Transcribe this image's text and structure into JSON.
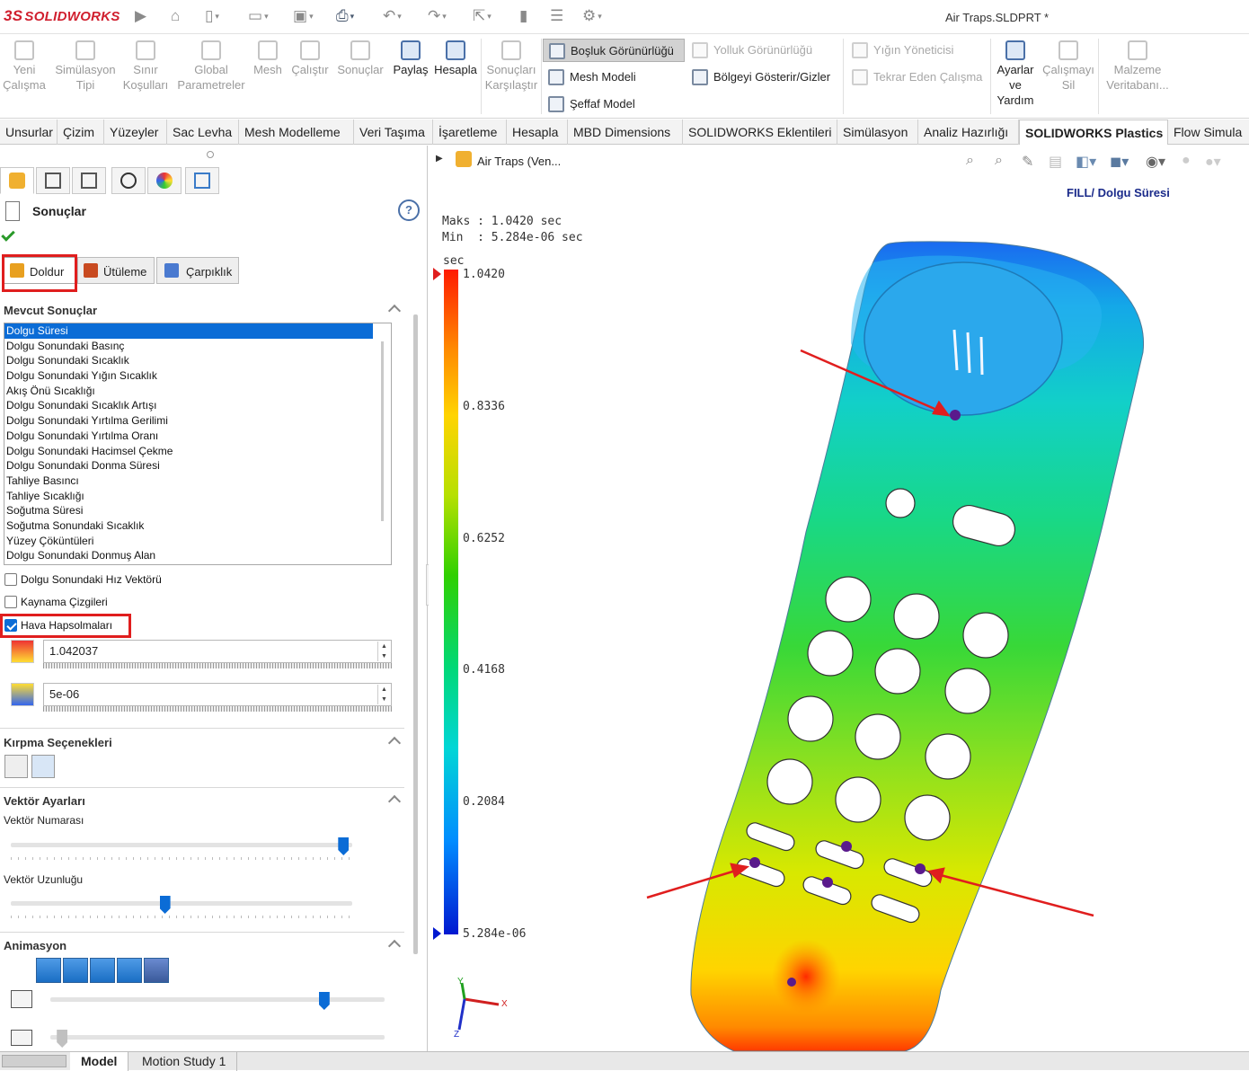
{
  "app": {
    "logo": "SOLIDWORKS",
    "logo_mark": "3S",
    "document_title": "Air Traps.SLDPRT *"
  },
  "ribbon": {
    "buttons": [
      {
        "label": "Yeni Çalışma",
        "icon": "new-study-icon",
        "enabled": false
      },
      {
        "label": "Simülasyon Tipi",
        "icon": "simulation-type-icon",
        "enabled": false
      },
      {
        "label": "Sınır Koşulları",
        "icon": "boundary-conditions-icon",
        "enabled": false
      },
      {
        "label": "Global Parametreler",
        "icon": "global-parameters-icon",
        "enabled": false
      },
      {
        "label": "Mesh",
        "icon": "mesh-icon",
        "enabled": false
      },
      {
        "label": "Çalıştır",
        "icon": "run-icon",
        "enabled": false
      },
      {
        "label": "Sonuçlar",
        "icon": "results-icon",
        "enabled": false
      },
      {
        "label": "Paylaş",
        "icon": "share-icon",
        "enabled": true
      },
      {
        "label": "Hesapla",
        "icon": "calculate-icon",
        "enabled": true
      },
      {
        "label": "Sonuçları Karşılaştır",
        "icon": "compare-results-icon",
        "enabled": false
      }
    ],
    "small_buttons": [
      {
        "label": "Boşluk Görünürlüğü",
        "icon": "cavity-visibility-icon",
        "selected": true
      },
      {
        "label": "Mesh Modeli",
        "icon": "mesh-model-icon"
      },
      {
        "label": "Şeffaf Model",
        "icon": "transparent-model-icon"
      },
      {
        "label": "Yolluk Görünürlüğü",
        "icon": "runner-visibility-icon",
        "enabled": false
      },
      {
        "label": "Bölgeyi Gösterir/Gizler",
        "icon": "show-hide-region-icon"
      },
      {
        "label": "Yığın Yöneticisi",
        "icon": "batch-manager-icon",
        "enabled": false
      },
      {
        "label": "Tekrar Eden Çalışma",
        "icon": "repeat-study-icon",
        "enabled": false
      }
    ],
    "right_buttons": [
      {
        "label": "Ayarlar ve Yardım",
        "icon": "settings-help-icon",
        "enabled": true
      },
      {
        "label": "Çalışmayı Sil",
        "icon": "delete-study-icon",
        "enabled": false
      },
      {
        "label": "Malzeme Veritabanı...",
        "icon": "material-database-icon",
        "enabled": false
      }
    ]
  },
  "tabs": [
    "Unsurlar",
    "Çizim",
    "Yüzeyler",
    "Sac Levha",
    "Mesh Modelleme",
    "Veri Taşıma",
    "İşaretleme",
    "Hesapla",
    "MBD Dimensions",
    "SOLIDWORKS Eklentileri",
    "Simülasyon",
    "Analiz Hazırlığı",
    "SOLIDWORKS Plastics",
    "Flow Simula"
  ],
  "active_tab": "SOLIDWORKS Plastics",
  "panel": {
    "title": "Sonuçlar",
    "subtabs": [
      "Doldur",
      "Ütüleme",
      "Çarpıklık"
    ],
    "section_results": "Mevcut Sonuçlar",
    "results": [
      "Dolgu Süresi",
      "Dolgu Sonundaki Basınç",
      "Dolgu Sonundaki Sıcaklık",
      "Dolgu Sonundaki Yığın Sıcaklık",
      "Akış Önü Sıcaklığı",
      "Dolgu Sonundaki Sıcaklık Artışı",
      "Dolgu Sonundaki Yırtılma Gerilimi",
      "Dolgu Sonundaki Yırtılma Oranı",
      "Dolgu Sonundaki Hacimsel Çekme",
      "Dolgu Sonundaki Donma Süresi",
      "Tahliye Basıncı",
      "Tahliye Sıcaklığı",
      "Soğutma Süresi",
      "Soğutma Sonundaki Sıcaklık",
      "Yüzey Çöküntüleri",
      "Dolgu Sonundaki Donmuş Alan"
    ],
    "checkboxes": [
      {
        "label": "Dolgu Sonundaki Hız Vektörü",
        "checked": false
      },
      {
        "label": "Kaynama Çizgileri",
        "checked": false
      },
      {
        "label": "Hava Hapsolmaları",
        "checked": true
      }
    ],
    "max_value": "1.042037",
    "min_value": "5e-06",
    "section_clip": "Kırpma Seçenekleri",
    "section_vector": "Vektör Ayarları",
    "vector_number_label": "Vektör Numarası",
    "vector_length_label": "Vektör Uzunluğu",
    "vector_number_level": 0.99,
    "vector_length_level": 0.45,
    "section_animation": "Animasyon",
    "frame_level": 0.83,
    "speed_level": 0.02
  },
  "viewport": {
    "tree_item": "Air Traps (Ven...",
    "plot_title": "FILL/ Dolgu Süresi",
    "maks_line": "Maks : 1.0420 sec",
    "min_line": "Min  : 5.284e-06 sec",
    "unit": "sec",
    "legend_ticks": [
      "1.0420",
      "0.8336",
      "0.6252",
      "0.4168",
      "0.2084",
      "5.284e-06"
    ],
    "axis_x": "X",
    "axis_y": "Y",
    "axis_z": "Z"
  },
  "bottom_tabs": [
    "Model",
    "Motion Study 1"
  ],
  "colors": {
    "brand_red": "#d01f2e",
    "highlight_red": "#e01e1e",
    "selection_blue": "#0b6cd6",
    "air_trap": "#5a1a8c"
  }
}
